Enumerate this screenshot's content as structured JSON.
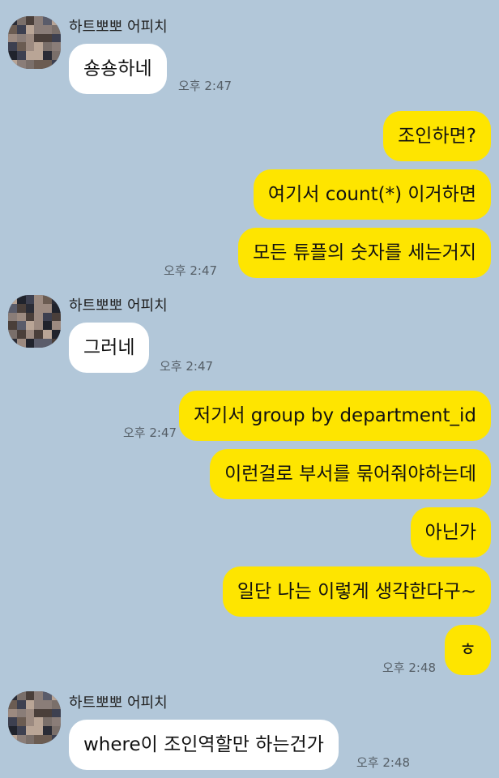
{
  "chat": {
    "messages": [
      {
        "type": "received",
        "sender": "하트뽀뽀 어피치",
        "avatar": "profile-avatar",
        "text": "숑숑하네",
        "time": "오후 2:47"
      },
      {
        "type": "sent",
        "text": "조인하면?"
      },
      {
        "type": "sent",
        "text": "여기서 count(*) 이거하면"
      },
      {
        "type": "sent",
        "text": "모든 튜플의 숫자를 세는거지",
        "time": "오후 2:47"
      },
      {
        "type": "received",
        "sender": "하트뽀뽀 어피치",
        "avatar": "profile-avatar",
        "text": "그러네",
        "time": "오후 2:47"
      },
      {
        "type": "sent",
        "text": "저기서 group by department_id",
        "time": "오후 2:47"
      },
      {
        "type": "sent",
        "text": "이런걸로 부서를 묶어줘야하는데"
      },
      {
        "type": "sent",
        "text": "아닌가"
      },
      {
        "type": "sent",
        "text": "일단 나는 이렇게 생각한다구~"
      },
      {
        "type": "sent",
        "text": "ㅎ",
        "time": "오후 2:48"
      },
      {
        "type": "received",
        "sender": "하트뽀뽀 어피치",
        "avatar": "profile-avatar",
        "text": "where이 조인역할만 하는건가",
        "time": "오후 2:48"
      }
    ]
  },
  "colors": {
    "background": "#b2c7d9",
    "sent_bubble": "#fee500",
    "received_bubble": "#ffffff"
  }
}
